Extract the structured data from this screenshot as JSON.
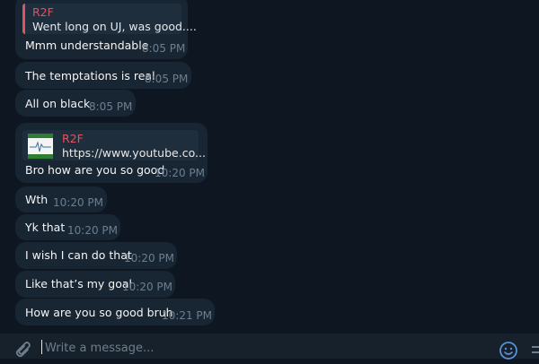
{
  "composer": {
    "placeholder": "Write a message..."
  },
  "messages": [
    {
      "reply": {
        "name": "R2F",
        "snippet": "Went long on UJ, was good...."
      },
      "text": "Mmm understandable",
      "time": "8:05 PM"
    },
    {
      "text": "The temptations is real",
      "time": "8:05 PM"
    },
    {
      "text": "All on black",
      "time": "8:05 PM"
    },
    {
      "reply": {
        "name": "R2F",
        "snippet": "https://www.youtube.co..."
      },
      "text": "Bro how are you so good",
      "time": "10:20 PM"
    },
    {
      "text": "Wth",
      "time": "10:20 PM"
    },
    {
      "text": "Yk that",
      "time": "10:20 PM"
    },
    {
      "text": "I wish I can do that",
      "time": "10:20 PM"
    },
    {
      "text": "Like that’s my goal",
      "time": "10:20 PM"
    },
    {
      "text": "How are you so good bruh",
      "time": "10:21 PM"
    }
  ],
  "colors": {
    "background": "#0e1621",
    "bubble": "#182533",
    "reply_accent": "#e05360",
    "timestamp": "#6d7f8f",
    "icon": "#5b8fd6"
  }
}
